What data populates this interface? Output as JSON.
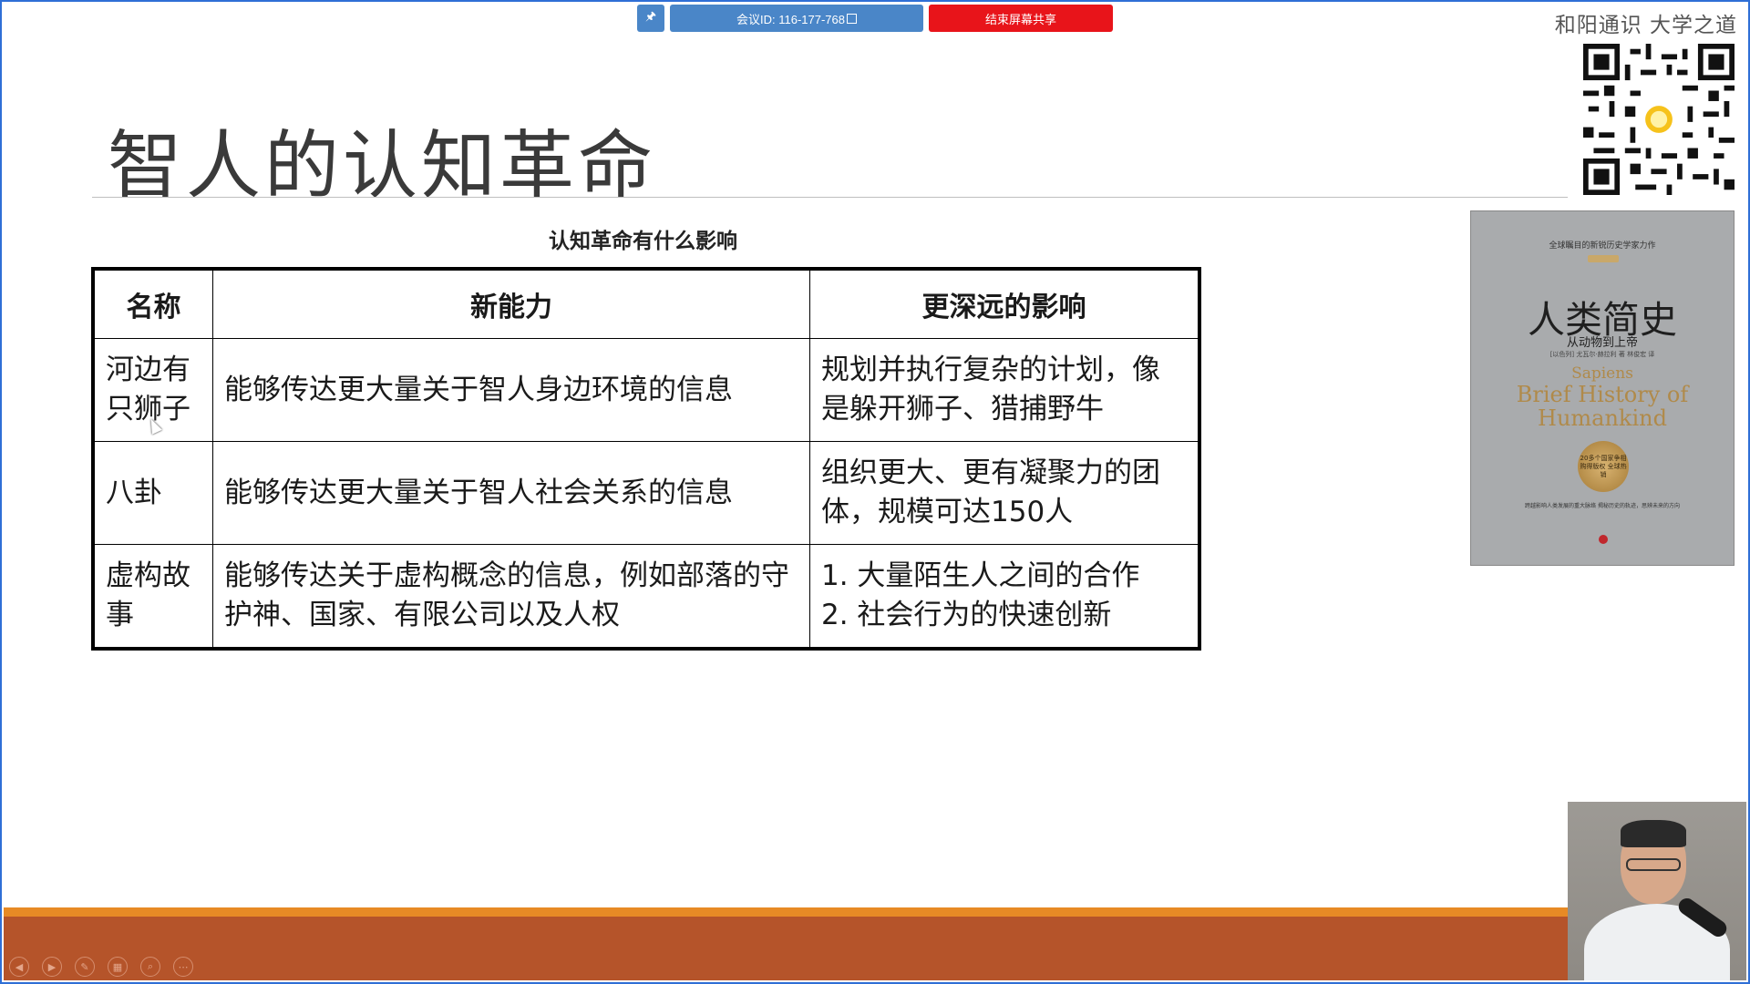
{
  "meeting_bar": {
    "meeting_id": "会议ID: 116-177-768",
    "end_share_label": "结束屏幕共享"
  },
  "brand": "和阳通识 大学之道",
  "slide": {
    "title": "智人的认知革命",
    "table_caption": "认知革命有什么影响",
    "table": {
      "headers": [
        "名称",
        "新能力",
        "更深远的影响"
      ],
      "rows": [
        [
          "河边有\n只狮子",
          "能够传达更大量关于智人身边环境的信息",
          "规划并执行复杂的计划，像是躲开狮子、猎捕野牛"
        ],
        [
          "八卦",
          "能够传达更大量关于智人社会关系的信息",
          "组织更大、更有凝聚力的团体，规模可达150人"
        ],
        [
          "虚构故事",
          "能够传达关于虚构概念的信息，例如部落的守护神、国家、有限公司以及人权",
          "1. 大量陌生人之间的合作\n2. 社会行为的快速创新"
        ]
      ]
    }
  },
  "book": {
    "tagline": "全球瞩目的新锐历史学家力作",
    "title": "人类简史",
    "subtitle": "从动物到上帝",
    "authors": "[以色列] 尤瓦尔·赫拉利 著 林俊宏 译",
    "english_1": "Sapiens",
    "english_2": "Brief History of Humankind",
    "medal": "20多个国家争相购得版权 全球热销",
    "blurb": "跨越影响人类发展的重大脉络 揭秘历史的轨迹，思辨未来的方向"
  },
  "icons": [
    "pin-icon",
    "copy-icon",
    "qr-code",
    "prev-icon",
    "next-icon",
    "pen-icon",
    "slides-icon",
    "zoom-icon",
    "more-icon"
  ]
}
